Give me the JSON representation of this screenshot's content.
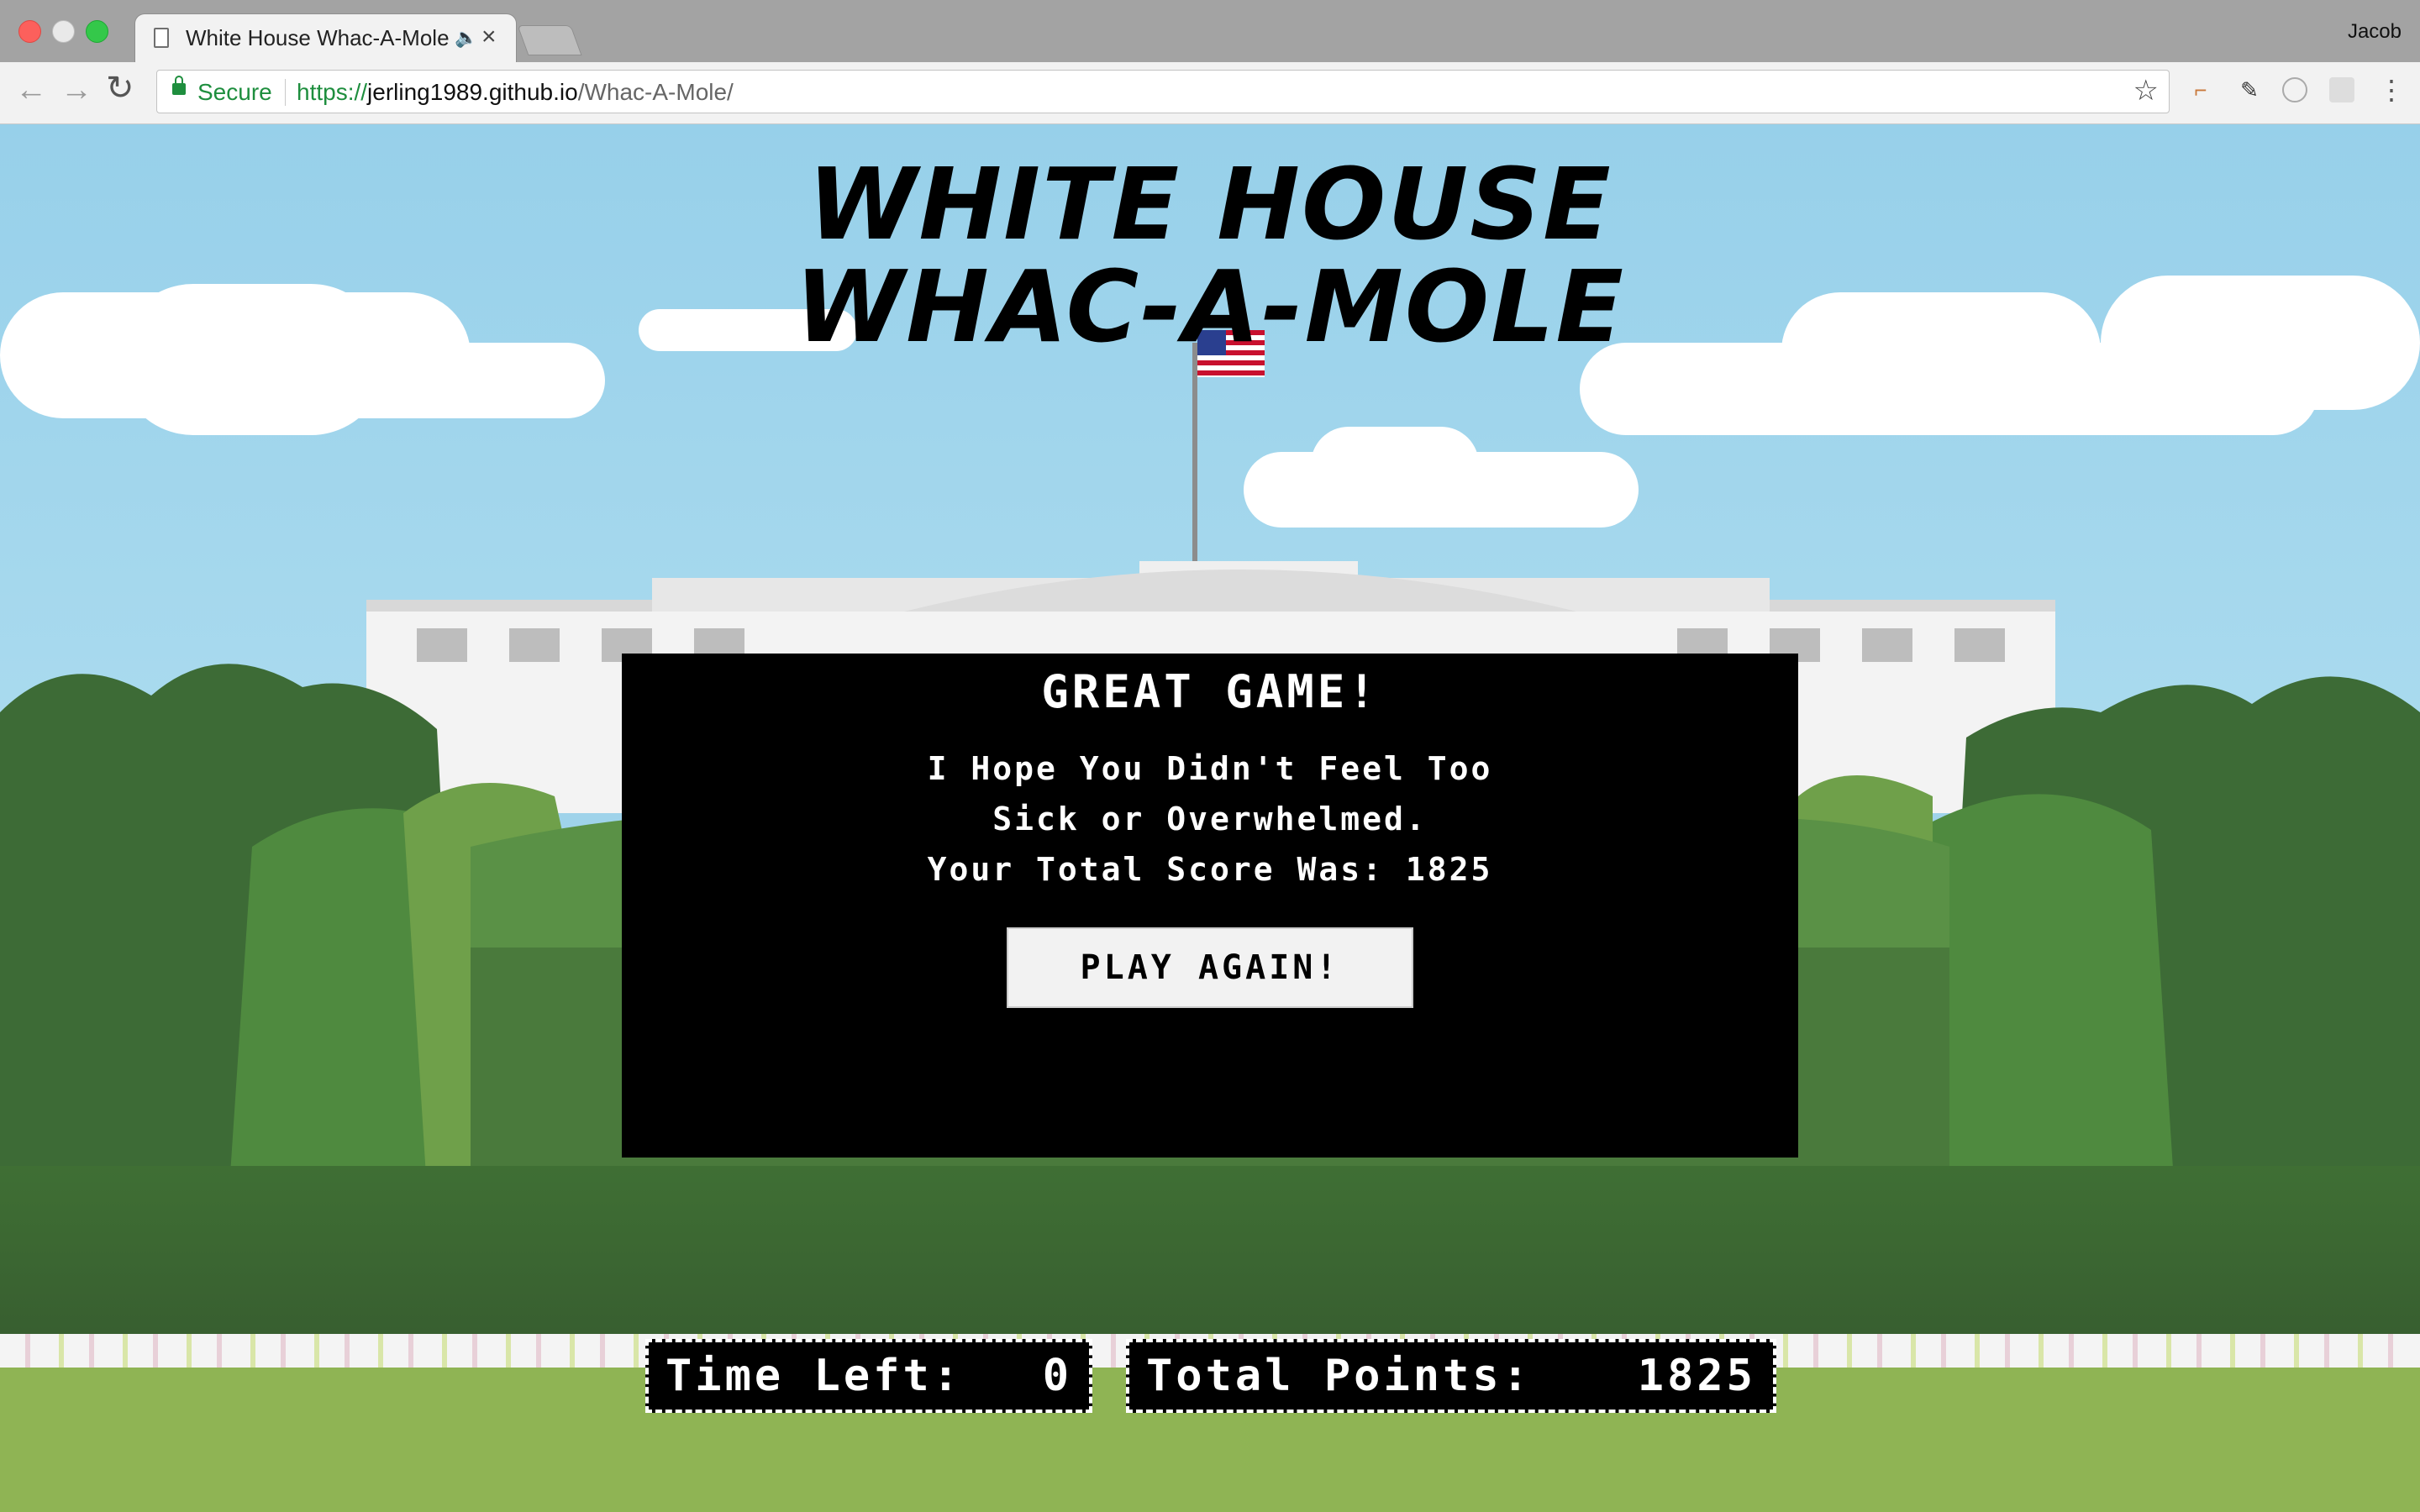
{
  "browser": {
    "tab_title": "White House Whac-A-Mole",
    "profile_name": "Jacob",
    "secure_label": "Secure",
    "url_scheme": "https://",
    "url_host": "jerling1989.github.io",
    "url_path": "/Whac-A-Mole/"
  },
  "game": {
    "title_line1": "WHITE HOUSE",
    "title_line2": "WHAC-A-MOLE",
    "modal": {
      "heading": "GREAT GAME!",
      "message_line1": "I Hope You Didn't Feel Too",
      "message_line2": "Sick or Overwhelmed.",
      "score_label": "Your Total Score Was:",
      "score_value": "1825",
      "play_again_label": "PLAY AGAIN!"
    },
    "stats": {
      "time_left_label": "Time Left:",
      "time_left_value": "0",
      "total_points_label": "Total Points:",
      "total_points_value": "1825"
    }
  },
  "colors": {
    "sky": "#9fd3ea",
    "hedge": "#3f6f34",
    "lawn": "#8fb454",
    "modal_bg": "#000000",
    "secure_green": "#1e8e3e"
  }
}
